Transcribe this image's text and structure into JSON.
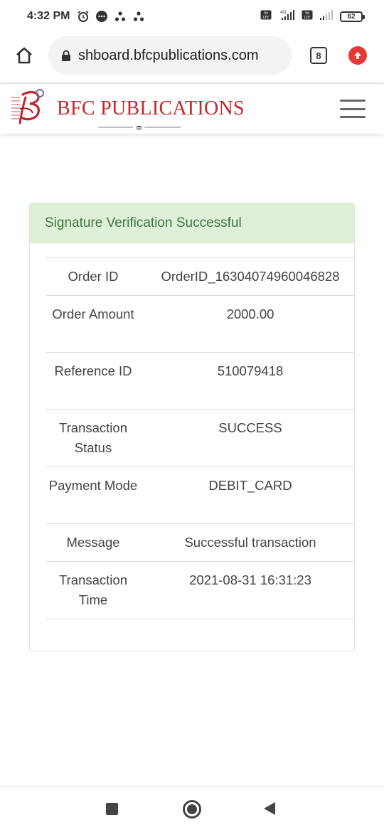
{
  "status_bar": {
    "time": "4:32 PM",
    "battery": "62",
    "network": "4G"
  },
  "browser": {
    "url": "shboard.bfcpublications.com",
    "tab_count": "8"
  },
  "site": {
    "brand": "BFC PUBLICATIONS",
    "brand_color": "#c0282d"
  },
  "card": {
    "header": "Signature Verification Successful",
    "rows": [
      {
        "label": "Order ID",
        "value": "OrderID_16304074960046828"
      },
      {
        "label": "Order Amount",
        "value": "2000.00"
      },
      {
        "label": "Reference ID",
        "value": "510079418"
      },
      {
        "label": "Transaction Status",
        "value": "SUCCESS"
      },
      {
        "label": "Payment Mode",
        "value": "DEBIT_CARD"
      },
      {
        "label": "Message",
        "value": "Successful transaction"
      },
      {
        "label": "Transaction Time",
        "value": "2021-08-31 16:31:23"
      }
    ]
  },
  "colors": {
    "success_bg": "#dff0d8",
    "success_text": "#3c763d",
    "update_badge": "#e53935"
  },
  "icons": {
    "home": "home-icon",
    "lock": "lock-icon",
    "update": "arrow-up-icon",
    "menu": "hamburger-menu-icon",
    "nav_recent": "square-icon",
    "nav_home": "circle-icon",
    "nav_back": "triangle-back-icon"
  }
}
